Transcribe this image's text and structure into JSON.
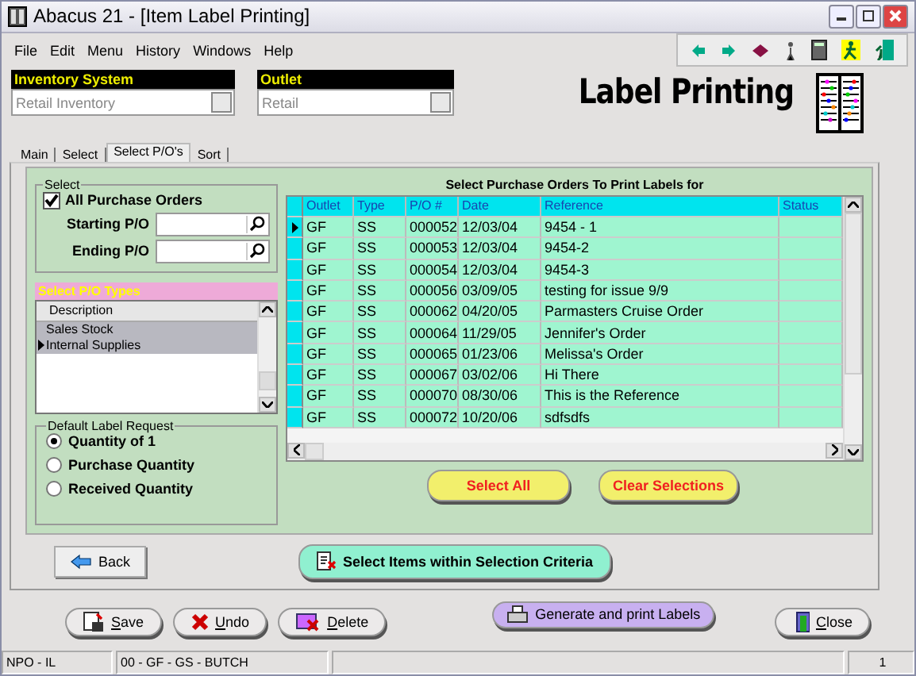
{
  "window": {
    "title": "Abacus 21 - [Item Label Printing]"
  },
  "menu": [
    "File",
    "Edit",
    "Menu",
    "History",
    "Windows",
    "Help"
  ],
  "inventory_system": {
    "label": "Inventory System",
    "value": "Retail Inventory"
  },
  "outlet": {
    "label": "Outlet",
    "value": "Retail"
  },
  "logo": {
    "text": "Label Printing"
  },
  "tabs": [
    {
      "label": "Main",
      "selected": false
    },
    {
      "label": "Select",
      "selected": false
    },
    {
      "label": "Select P/O's",
      "selected": true
    },
    {
      "label": "Sort",
      "selected": false
    }
  ],
  "select_group": {
    "title": "Select",
    "all_orders": {
      "label": "All Purchase Orders",
      "checked": true
    },
    "starting_label": "Starting P/O",
    "ending_label": "Ending P/O"
  },
  "po_types": {
    "title": "Select P/O Types",
    "column": "Description",
    "items": [
      {
        "label": "Sales Stock",
        "current": false
      },
      {
        "label": "Internal Supplies",
        "current": true
      }
    ]
  },
  "default_label": {
    "title": "Default Label Request",
    "options": [
      {
        "label": "Quantity of 1",
        "selected": true
      },
      {
        "label": "Purchase Quantity",
        "selected": false
      },
      {
        "label": "Received Quantity",
        "selected": false
      }
    ]
  },
  "grid": {
    "title": "Select Purchase Orders To Print Labels for",
    "columns": [
      "Outlet",
      "Type",
      "P/O #",
      "Date",
      "Reference",
      "Status"
    ],
    "rows": [
      {
        "outlet": "GF",
        "type": "SS",
        "po": "000052",
        "date": "12/03/04",
        "reference": "9454 - 1",
        "current": true
      },
      {
        "outlet": "GF",
        "type": "SS",
        "po": "000053",
        "date": "12/03/04",
        "reference": "9454-2",
        "current": false
      },
      {
        "outlet": "GF",
        "type": "SS",
        "po": "000054",
        "date": "12/03/04",
        "reference": "9454-3",
        "current": false
      },
      {
        "outlet": "GF",
        "type": "SS",
        "po": "000056",
        "date": "03/09/05",
        "reference": "testing for issue 9/9",
        "current": false
      },
      {
        "outlet": "GF",
        "type": "SS",
        "po": "000062",
        "date": "04/20/05",
        "reference": "Parmasters Cruise Order",
        "current": false
      },
      {
        "outlet": "GF",
        "type": "SS",
        "po": "000064",
        "date": "11/29/05",
        "reference": "Jennifer's Order",
        "current": false
      },
      {
        "outlet": "GF",
        "type": "SS",
        "po": "000065",
        "date": "01/23/06",
        "reference": "Melissa's Order",
        "current": false
      },
      {
        "outlet": "GF",
        "type": "SS",
        "po": "000067",
        "date": "03/02/06",
        "reference": "Hi There",
        "current": false
      },
      {
        "outlet": "GF",
        "type": "SS",
        "po": "000070",
        "date": "08/30/06",
        "reference": "This is the Reference",
        "current": false
      },
      {
        "outlet": "GF",
        "type": "SS",
        "po": "000072",
        "date": "10/20/06",
        "reference": "sdfsdfs",
        "current": false
      }
    ]
  },
  "select_all": "Select  All",
  "clear_selections": "Clear Selections",
  "back": "Back",
  "select_items": "Select Items within Selection Criteria",
  "bottom_buttons": [
    {
      "label": "Save",
      "kind": "save"
    },
    {
      "label": "Undo",
      "kind": "undo"
    },
    {
      "label": "Delete",
      "kind": "delete"
    }
  ],
  "generate": "Generate and print Labels",
  "close": "Close",
  "status_bar": [
    "NPO - IL",
    "00 - GF - GS - BUTCH",
    "1"
  ]
}
